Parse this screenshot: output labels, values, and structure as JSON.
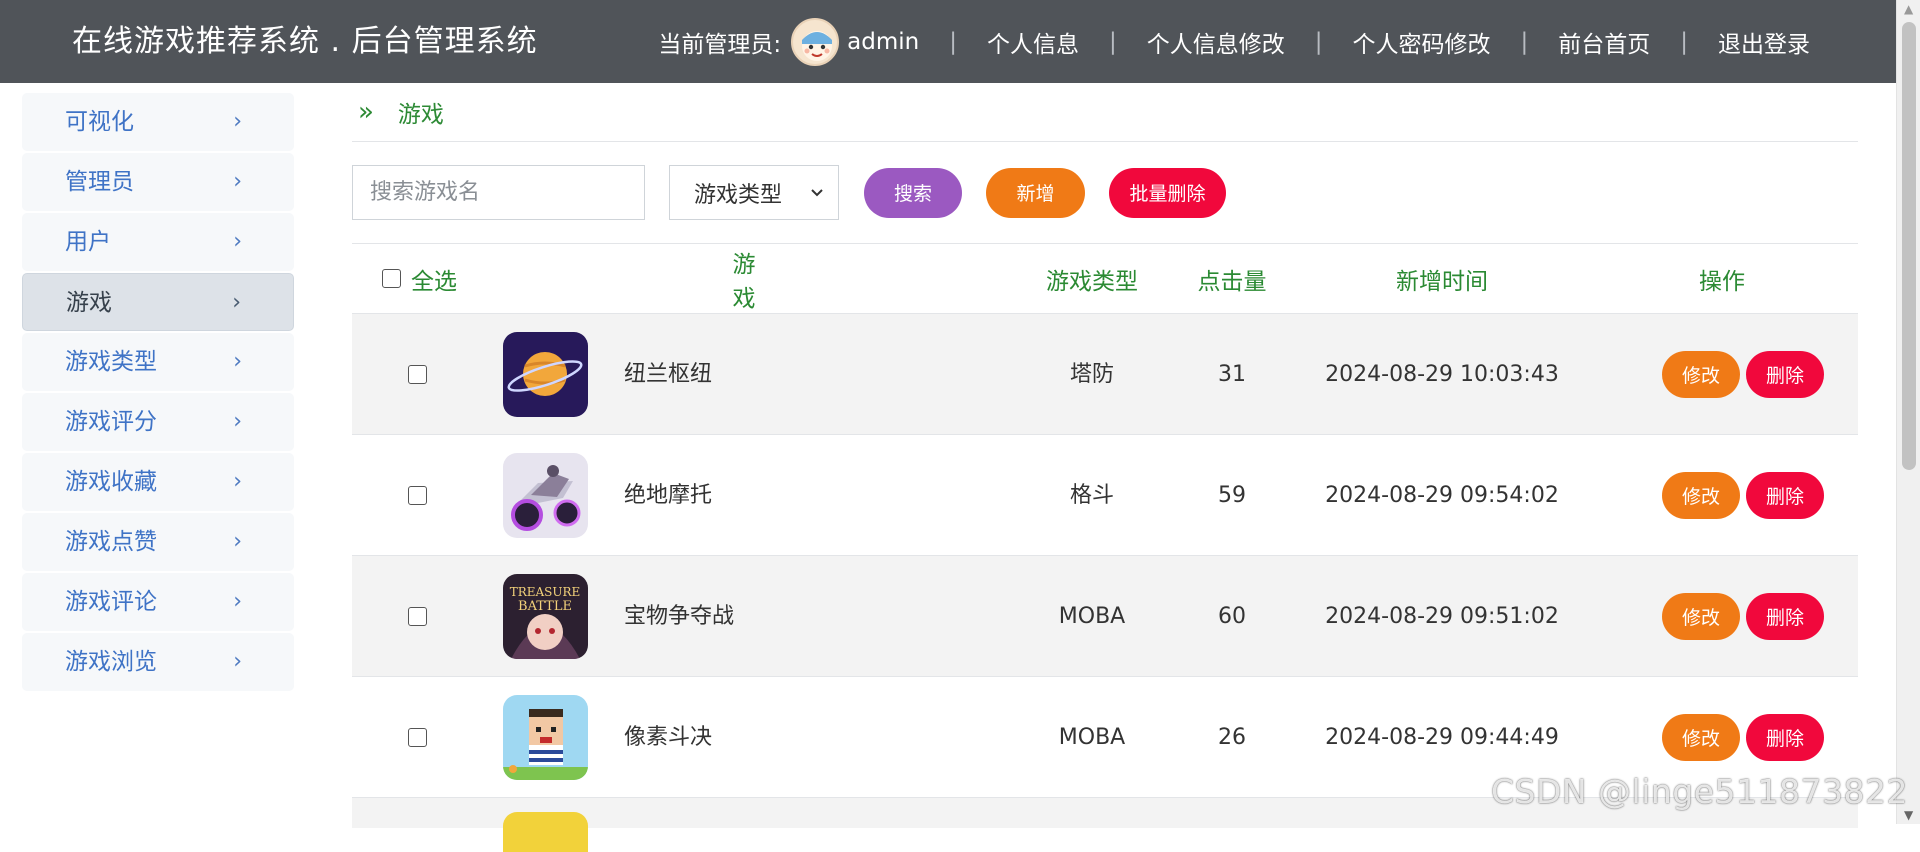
{
  "header": {
    "title": "在线游戏推荐系统 . 后台管理系统",
    "admin_label": "当前管理员:",
    "admin_name": "admin",
    "nav": [
      "个人信息",
      "个人信息修改",
      "个人密码修改",
      "前台首页",
      "退出登录"
    ],
    "separator": "|"
  },
  "sidebar": {
    "items": [
      {
        "label": "可视化",
        "active": false
      },
      {
        "label": "管理员",
        "active": false
      },
      {
        "label": "用户",
        "active": false
      },
      {
        "label": "游戏",
        "active": true
      },
      {
        "label": "游戏类型",
        "active": false
      },
      {
        "label": "游戏评分",
        "active": false
      },
      {
        "label": "游戏收藏",
        "active": false
      },
      {
        "label": "游戏点赞",
        "active": false
      },
      {
        "label": "游戏评论",
        "active": false
      },
      {
        "label": "游戏浏览",
        "active": false
      }
    ],
    "chevron": "›"
  },
  "breadcrumb": {
    "arrows": "»",
    "current": "游戏"
  },
  "toolbar": {
    "search_placeholder": "搜索游戏名",
    "type_select": "游戏类型",
    "search_button": "搜索",
    "add_button": "新增",
    "batch_delete_button": "批量删除"
  },
  "table": {
    "headers": {
      "select_all": "全选",
      "game": "游戏",
      "type": "游戏类型",
      "clicks": "点击量",
      "time": "新增时间",
      "ops": "操作"
    },
    "rows": [
      {
        "name": "纽兰枢纽",
        "type": "塔防",
        "clicks": "31",
        "time": "2024-08-29 10:03:43",
        "icon": "planet-icon"
      },
      {
        "name": "绝地摩托",
        "type": "格斗",
        "clicks": "59",
        "time": "2024-08-29 09:54:02",
        "icon": "motorbike-icon"
      },
      {
        "name": "宝物争夺战",
        "type": "MOBA",
        "clicks": "60",
        "time": "2024-08-29 09:51:02",
        "icon": "treasure-battle-icon",
        "icon_text": "TREASURE BATTLE"
      },
      {
        "name": "像素斗决",
        "type": "MOBA",
        "clicks": "26",
        "time": "2024-08-29 09:44:49",
        "icon": "pixel-character-icon"
      }
    ],
    "edit_label": "修改",
    "delete_label": "删除"
  },
  "watermark": "CSDN @linge511873822",
  "colors": {
    "topbar": "#505459",
    "accent_green": "#2b8a33",
    "link_blue": "#3f73c6",
    "purple": "#9b59c1",
    "orange": "#f07a16",
    "red": "#f1083c"
  }
}
